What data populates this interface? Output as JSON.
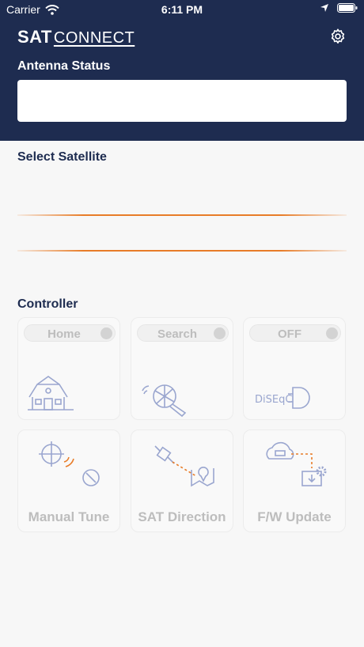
{
  "status_bar": {
    "carrier": "Carrier",
    "time": "6:11 PM"
  },
  "brand": {
    "sat": "SAT",
    "connect": "CONNECT"
  },
  "antenna": {
    "label": "Antenna Status"
  },
  "satellite": {
    "label": "Select Satellite"
  },
  "controller": {
    "label": "Controller",
    "toggles": [
      {
        "label": "Home",
        "icon": "house-icon"
      },
      {
        "label": "Search",
        "icon": "search-satellite-icon"
      },
      {
        "label": "OFF",
        "icon": "diseqc-icon"
      }
    ],
    "actions": [
      {
        "label": "Manual Tune",
        "icon": "manual-tune-icon"
      },
      {
        "label": "SAT Direction",
        "icon": "sat-direction-icon"
      },
      {
        "label": "F/W Update",
        "icon": "firmware-update-icon"
      }
    ]
  },
  "colors": {
    "header": "#1e2c50",
    "accent": "#e87c28",
    "icon": "#9aa6cf"
  }
}
